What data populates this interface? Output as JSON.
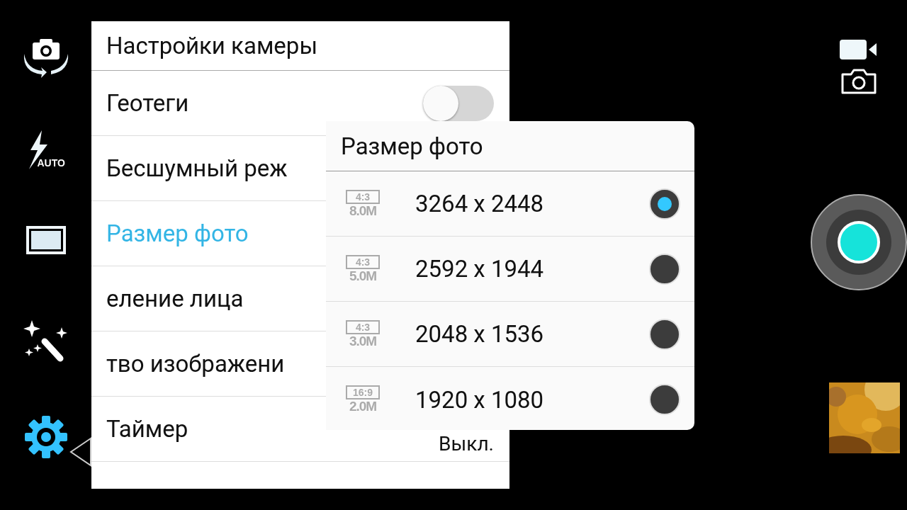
{
  "left_rail": [
    {
      "kind": "switch-camera"
    },
    {
      "kind": "flash",
      "label": "AUTO"
    },
    {
      "kind": "frame"
    },
    {
      "kind": "effects"
    },
    {
      "kind": "settings",
      "selected": true
    }
  ],
  "settings": {
    "title": "Настройки камеры",
    "rows": [
      {
        "label": "Геотеги",
        "kind": "toggle",
        "on": false,
        "selected": false
      },
      {
        "label": "Бесшумный реж",
        "kind": "plain",
        "selected": false
      },
      {
        "label": "Размер фото",
        "kind": "plain",
        "selected": true
      },
      {
        "label": "еление лица",
        "kind": "plain",
        "selected": false
      },
      {
        "label": "тво изображени",
        "kind": "plain",
        "selected": false
      },
      {
        "label": "Таймер",
        "kind": "value",
        "value": "Выкл.",
        "selected": false
      }
    ]
  },
  "popup": {
    "title": "Размер фото",
    "options": [
      {
        "ratio": "4:3",
        "megapixels": "8.0M",
        "resolution": "3264 x 2448",
        "selected": true
      },
      {
        "ratio": "4:3",
        "megapixels": "5.0M",
        "resolution": "2592 x 1944",
        "selected": false
      },
      {
        "ratio": "4:3",
        "megapixels": "3.0M",
        "resolution": "2048 x 1536",
        "selected": false
      },
      {
        "ratio": "16:9",
        "megapixels": "2.0M",
        "resolution": "1920 x 1080",
        "selected": false
      }
    ]
  }
}
